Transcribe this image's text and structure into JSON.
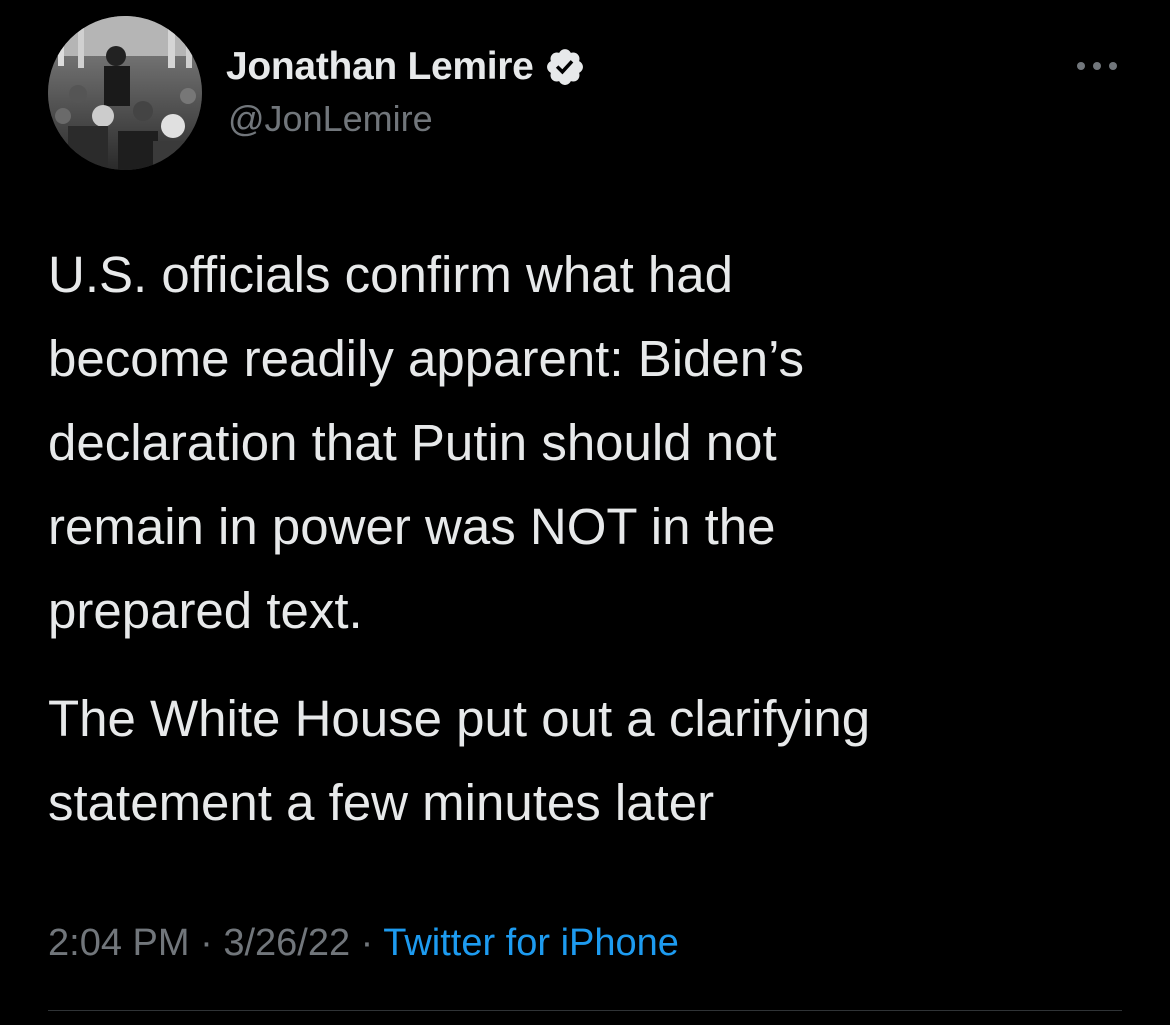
{
  "author": {
    "display_name": "Jonathan Lemire",
    "handle": "@JonLemire",
    "verified": true
  },
  "tweet": {
    "paragraphs": [
      {
        "lines": [
          "U.S. officials confirm what had",
          "become readily apparent: Biden’s",
          "declaration that Putin should not",
          "remain in power was NOT in the",
          "prepared text."
        ]
      },
      {
        "lines": [
          "The White House put out a clarifying",
          "statement a few minutes later"
        ]
      }
    ],
    "time": "2:04 PM",
    "separator": "·",
    "date": "3/26/22",
    "source": "Twitter for iPhone"
  },
  "icons": {
    "verified": "verified-badge-icon",
    "more": "more-options-icon"
  },
  "colors": {
    "background": "#000000",
    "primary_text": "#e7e9ea",
    "secondary_text": "#71767b",
    "link": "#1d9bf0",
    "divider": "#2f3336"
  }
}
